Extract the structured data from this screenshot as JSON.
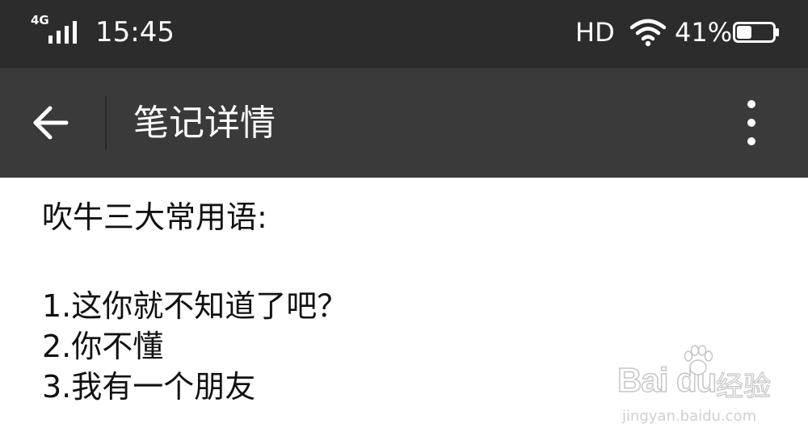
{
  "status_bar": {
    "network_label": "4G",
    "time": "15:45",
    "hd_label": "HD",
    "battery_percent": "41%",
    "battery_level": 0.41,
    "icons": [
      "signal-icon",
      "wifi-icon",
      "battery-icon"
    ]
  },
  "app_bar": {
    "title": "笔记详情",
    "icons": [
      "back-arrow-icon",
      "more-vertical-icon"
    ]
  },
  "note": {
    "heading": "吹牛三大常用语:",
    "items": [
      "1.这你就不知道了吧？",
      "2.你不懂",
      "3.我有一个朋友"
    ]
  },
  "watermark": {
    "brand": "Bai du",
    "label": "经验",
    "url": "jingyan.baidu.com"
  },
  "colors": {
    "status_bar_bg": "#2c2c2c",
    "app_bar_bg": "#3a3a3b",
    "content_bg": "#ffffff",
    "text": "#111111"
  }
}
